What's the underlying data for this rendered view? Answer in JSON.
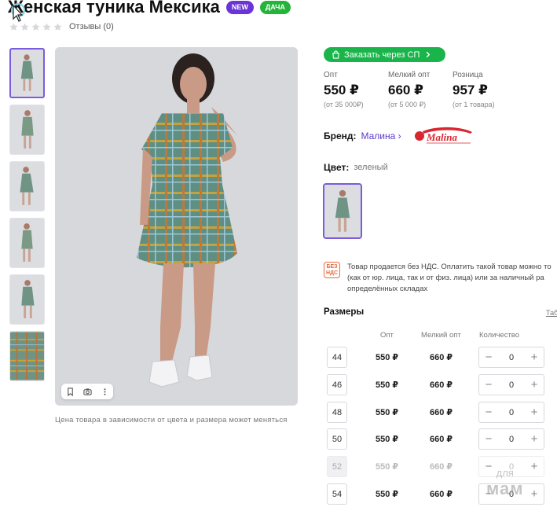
{
  "product": {
    "title": "Женская туника Мексика",
    "badges": [
      "NEW",
      "ДАЧА"
    ],
    "reviews_label": "Отзывы (0)",
    "rating_stars": 0,
    "rating_max": 5
  },
  "gallery": {
    "thumb_count": 6,
    "active_thumb": 0,
    "tools": [
      "bookmark-icon",
      "camera-search-icon",
      "more-icon"
    ],
    "price_note": "Цена товара в зависимости от цвета и размера может меняться"
  },
  "order": {
    "button_label": "Заказать через СП",
    "button_color": "#19b54b"
  },
  "prices": [
    {
      "label": "Опт",
      "value": "550 ₽",
      "sub": "(от 35 000₽)"
    },
    {
      "label": "Мелкий опт",
      "value": "660 ₽",
      "sub": "(от 5 000 ₽)"
    },
    {
      "label": "Розница",
      "value": "957 ₽",
      "sub": "(от 1 товара)"
    }
  ],
  "brand": {
    "key": "Бренд:",
    "name": "Малина",
    "logo_text": "Malina"
  },
  "color": {
    "key": "Цвет:",
    "value": "зеленый"
  },
  "vat": {
    "icon_text": "БЕЗ НДС",
    "lines": [
      "Товар продается без НДС. Оплатить такой товар можно то",
      "(как от юр. лица, так и от физ. лица) или за наличный ра",
      "определённых складах"
    ]
  },
  "sizes": {
    "title": "Размеры",
    "table_link": "Таб",
    "headers": {
      "opt": "Опт",
      "small_opt": "Мелкий опт",
      "qty": "Количество"
    },
    "rows": [
      {
        "size": "44",
        "opt": "550 ₽",
        "small_opt": "660 ₽",
        "qty": "0",
        "available": true
      },
      {
        "size": "46",
        "opt": "550 ₽",
        "small_opt": "660 ₽",
        "qty": "0",
        "available": true
      },
      {
        "size": "48",
        "opt": "550 ₽",
        "small_opt": "660 ₽",
        "qty": "0",
        "available": true
      },
      {
        "size": "50",
        "opt": "550 ₽",
        "small_opt": "660 ₽",
        "qty": "0",
        "available": true
      },
      {
        "size": "52",
        "opt": "550 ₽",
        "small_opt": "660 ₽",
        "qty": "0",
        "available": false
      },
      {
        "size": "54",
        "opt": "550 ₽",
        "small_opt": "660 ₽",
        "qty": "0",
        "available": true
      }
    ]
  },
  "watermark": {
    "top": "для",
    "bottom": "мам"
  },
  "colors": {
    "accent": "#6a34d6",
    "green": "#19b54b",
    "brand_link": "#5b39c8"
  }
}
